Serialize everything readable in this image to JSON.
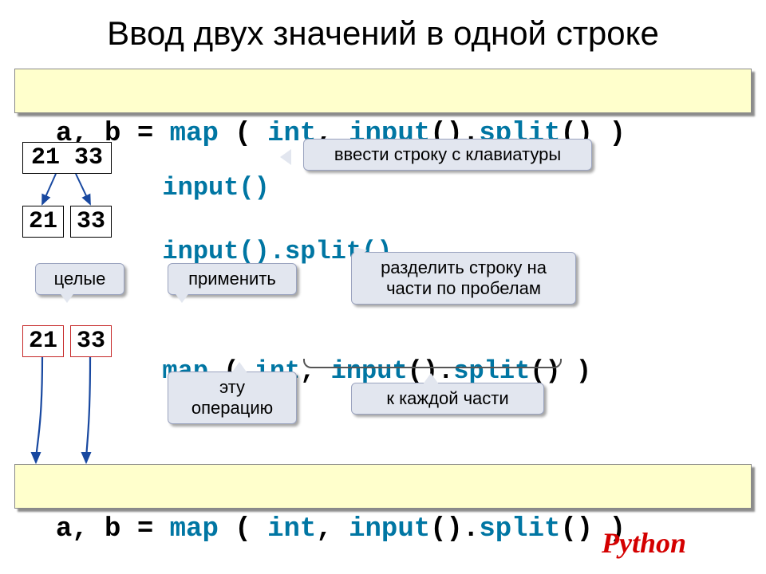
{
  "title": "Ввод двух значений в одной строке",
  "code": {
    "ab": "a, b = ",
    "map": "map",
    "open": " ( ",
    "int": "int",
    "comma": ", ",
    "input": "input",
    "par": "().",
    "par0": "()",
    "split": "split",
    "end": "() )"
  },
  "vals": {
    "v1": "21",
    "v2": "33",
    "pair": "21 33"
  },
  "rows": {
    "r1": "input()",
    "r2a": "input().",
    "r2b": "split()",
    "r3a": "map",
    "r3b": " ( ",
    "r3c": "int",
    "r3d": ", ",
    "r3e": "input",
    "r3f": "().",
    "r3g": "split",
    "r3h": "() )"
  },
  "callouts": {
    "c1": "ввести строку с клавиатуры",
    "c2": "разделить строку на\nчасти по пробелам",
    "c3": "целые",
    "c4": "применить",
    "c5": "эту\nоперацию",
    "c6": "к каждой части"
  },
  "lang": "Python"
}
